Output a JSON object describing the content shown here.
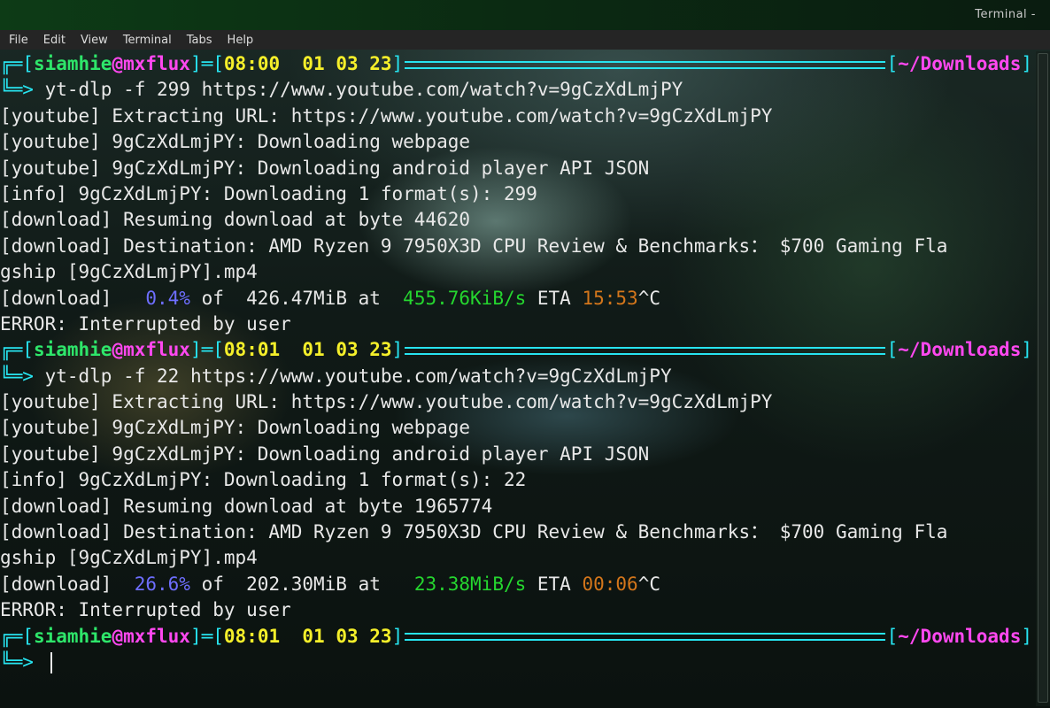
{
  "window": {
    "title": "Terminal -"
  },
  "menu": [
    "File",
    "Edit",
    "View",
    "Terminal",
    "Tabs",
    "Help"
  ],
  "colors": {
    "prompt_frame": "#27e4f0",
    "user": "#2ee66a",
    "host": "#ff48f0",
    "time": "#f5ef2a",
    "percent": "#6e6eff",
    "speed": "#25d62f",
    "eta": "#d4761b"
  },
  "blocks": [
    {
      "prompt": {
        "user": "siamhie",
        "at": "@",
        "host": "mxflux",
        "time": "08:00  01 03 23",
        "dir": "~/Downloads",
        "command": "yt-dlp -f 299 https://www.youtube.com/watch?v=9gCzXdLmjPY"
      },
      "output": [
        "[youtube] Extracting URL: https://www.youtube.com/watch?v=9gCzXdLmjPY",
        "[youtube] 9gCzXdLmjPY: Downloading webpage",
        "[youtube] 9gCzXdLmjPY: Downloading android player API JSON",
        "[info] 9gCzXdLmjPY: Downloading 1 format(s): 299",
        "[download] Resuming download at byte 44620",
        "[download] Destination: AMD Ryzen 9 7950X3D CPU Review & Benchmarks： $700 Gaming Fla",
        "gship [9gCzXdLmjPY].mp4"
      ],
      "progress": {
        "prefix": "[download]   ",
        "percent": "0.4%",
        "of": " of  426.47MiB at  ",
        "speed": "455.76KiB/s",
        "eta_label": " ETA ",
        "eta": "15:53",
        "suffix": "^C"
      },
      "error": "ERROR: Interrupted by user"
    },
    {
      "prompt": {
        "user": "siamhie",
        "at": "@",
        "host": "mxflux",
        "time": "08:01  01 03 23",
        "dir": "~/Downloads",
        "command": "yt-dlp -f 22 https://www.youtube.com/watch?v=9gCzXdLmjPY"
      },
      "output": [
        "[youtube] Extracting URL: https://www.youtube.com/watch?v=9gCzXdLmjPY",
        "[youtube] 9gCzXdLmjPY: Downloading webpage",
        "[youtube] 9gCzXdLmjPY: Downloading android player API JSON",
        "[info] 9gCzXdLmjPY: Downloading 1 format(s): 22",
        "[download] Resuming download at byte 1965774",
        "[download] Destination: AMD Ryzen 9 7950X3D CPU Review & Benchmarks： $700 Gaming Fla",
        "gship [9gCzXdLmjPY].mp4"
      ],
      "progress": {
        "prefix": "[download]  ",
        "percent": "26.6%",
        "of": " of  202.30MiB at   ",
        "speed": "23.38MiB/s",
        "eta_label": " ETA ",
        "eta": "00:06",
        "suffix": "^C"
      },
      "error": "ERROR: Interrupted by user"
    }
  ],
  "final_prompt": {
    "user": "siamhie",
    "at": "@",
    "host": "mxflux",
    "time": "08:01  01 03 23",
    "dir": "~/Downloads",
    "command": ""
  }
}
